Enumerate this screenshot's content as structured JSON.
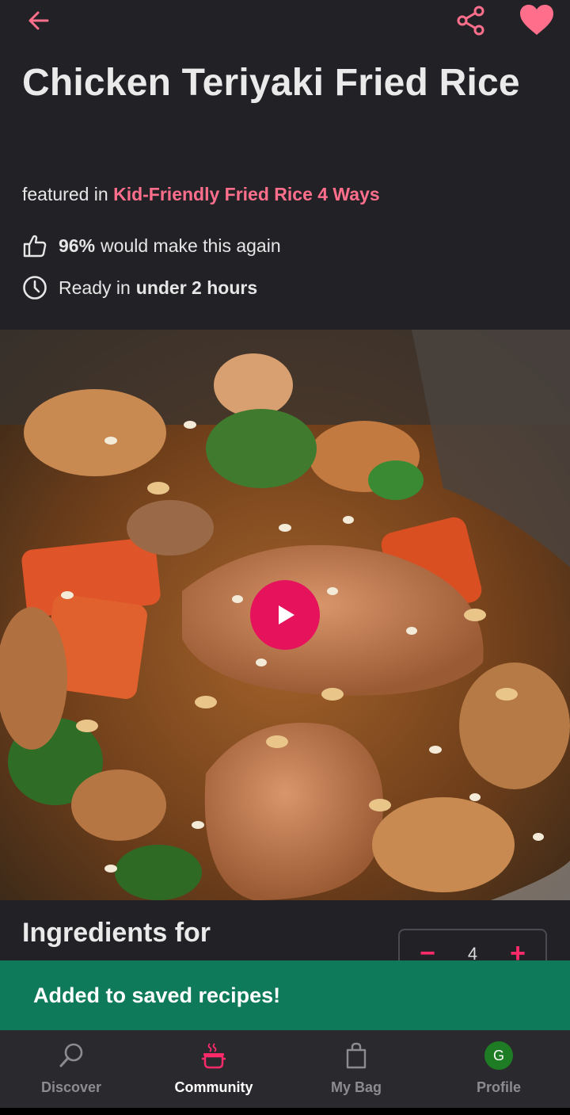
{
  "header": {
    "back_icon": "arrow-left-icon",
    "share_icon": "share-icon",
    "favorite_icon": "heart-icon",
    "accent_color": "#ff6f8c"
  },
  "recipe": {
    "title": "Chicken Teriyaki Fried Rice",
    "featured_prefix": "featured in",
    "featured_link": "Kid-Friendly Fried Rice 4 Ways",
    "rating_value": "96%",
    "rating_text": "would make this again",
    "ready_prefix": "Ready in",
    "ready_value": "under 2 hours"
  },
  "media": {
    "play_icon": "play-icon",
    "play_color": "#e6135c"
  },
  "ingredients": {
    "heading": "Ingredients for",
    "servings": "4",
    "minus_label": "−",
    "plus_label": "+"
  },
  "toast": {
    "message": "Added to saved recipes!",
    "color": "#0f7a5a"
  },
  "nav": {
    "items": [
      {
        "label": "Discover",
        "icon": "search-icon"
      },
      {
        "label": "Community",
        "icon": "cooking-pot-icon"
      },
      {
        "label": "My Bag",
        "icon": "shopping-bag-icon"
      },
      {
        "label": "Profile",
        "icon": "avatar"
      }
    ],
    "active": "Community",
    "avatar_initial": "G"
  }
}
